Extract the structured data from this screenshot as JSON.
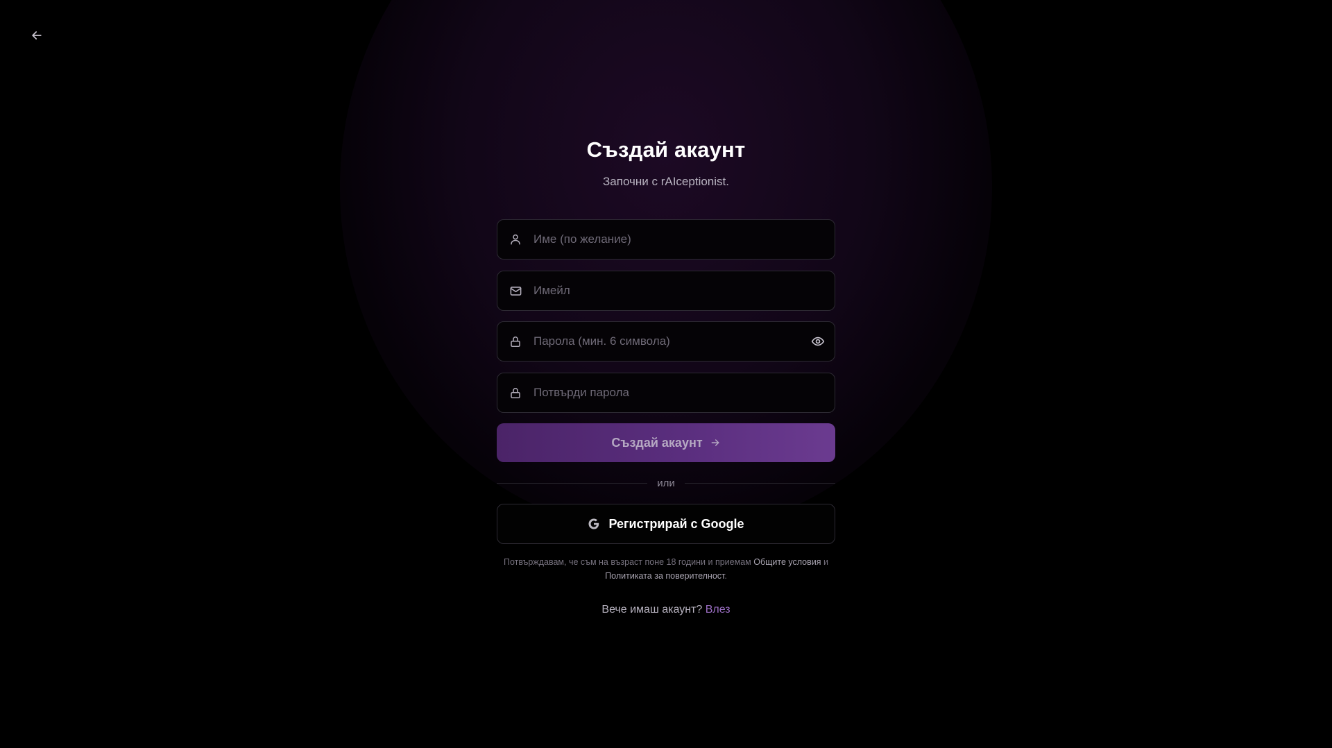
{
  "nav": {
    "back_icon": "arrow-left-icon"
  },
  "header": {
    "title": "Създай акаунт",
    "subtitle": "Започни с rAIceptionist."
  },
  "form": {
    "name": {
      "placeholder": "Име (по желание)",
      "value": "",
      "icon": "user-icon"
    },
    "email": {
      "placeholder": "Имейл",
      "value": "",
      "icon": "mail-icon"
    },
    "password": {
      "placeholder": "Парола (мин. 6 символа)",
      "value": "",
      "icon": "lock-icon",
      "toggle_icon": "eye-icon"
    },
    "confirm_password": {
      "placeholder": "Потвърди парола",
      "value": "",
      "icon": "lock-icon"
    },
    "submit_label": "Създай акаунт",
    "submit_icon": "arrow-right-icon",
    "divider_text": "или",
    "google_label": "Регистрирай с Google",
    "google_icon": "google-icon"
  },
  "terms": {
    "prefix": "Потвърждавам, че съм на възраст поне 18 години и приемам ",
    "terms_link": "Общите условия",
    "conjunction": " и ",
    "privacy_link": "Политиката за поверителност",
    "suffix": "."
  },
  "signin": {
    "prompt": "Вече имаш акаунт?",
    "link": "Влез"
  },
  "colors": {
    "background": "#000000",
    "accent": "#5a2e7e",
    "link": "#9c6fc4"
  }
}
